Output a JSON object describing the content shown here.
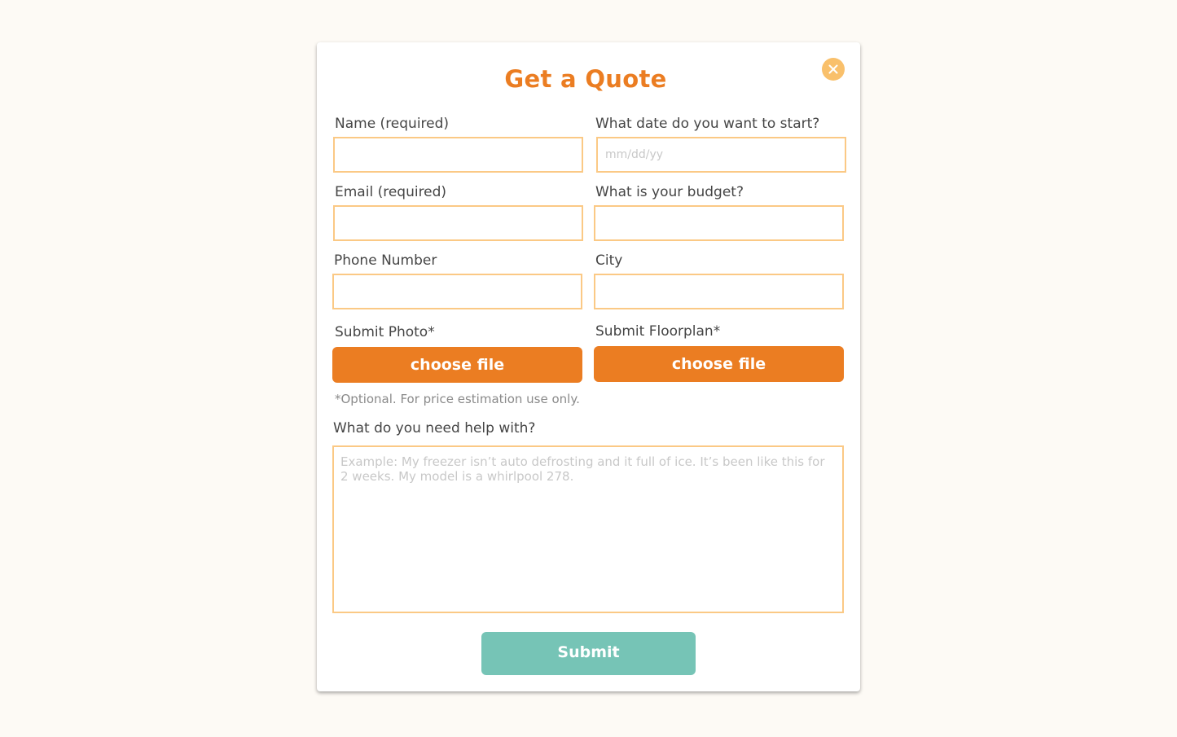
{
  "modal": {
    "title": "Get a Quote",
    "close_icon": "close-icon"
  },
  "form": {
    "name_label": "Name (required)",
    "name_value": "",
    "start_date_label": "What date do you want to start?",
    "start_date_placeholder": "mm/dd/yy",
    "email_label": "Email (required)",
    "email_value": "",
    "budget_label": "What is your budget?",
    "budget_value": "",
    "phone_label": "Phone Number",
    "phone_value": "",
    "city_label": "City",
    "city_value": "",
    "photo_label": "Submit Photo*",
    "photo_button": "choose file",
    "floorplan_label": "Submit Floorplan*",
    "floorplan_button": "choose file",
    "optional_note": "*Optional. For price estimation use only.",
    "help_label": "What do you need help with?",
    "help_placeholder": "Example: My freezer isn’t auto defrosting and it full of ice. It’s been like this for 2 weeks. My model is a whirlpool 278.",
    "submit_label": "Submit"
  },
  "colors": {
    "accent": "#eb7d22",
    "field_border": "#fbc985",
    "close_bg": "#f9c06b",
    "submit_bg": "#76c4b6",
    "page_bg": "#fdfaf5"
  }
}
